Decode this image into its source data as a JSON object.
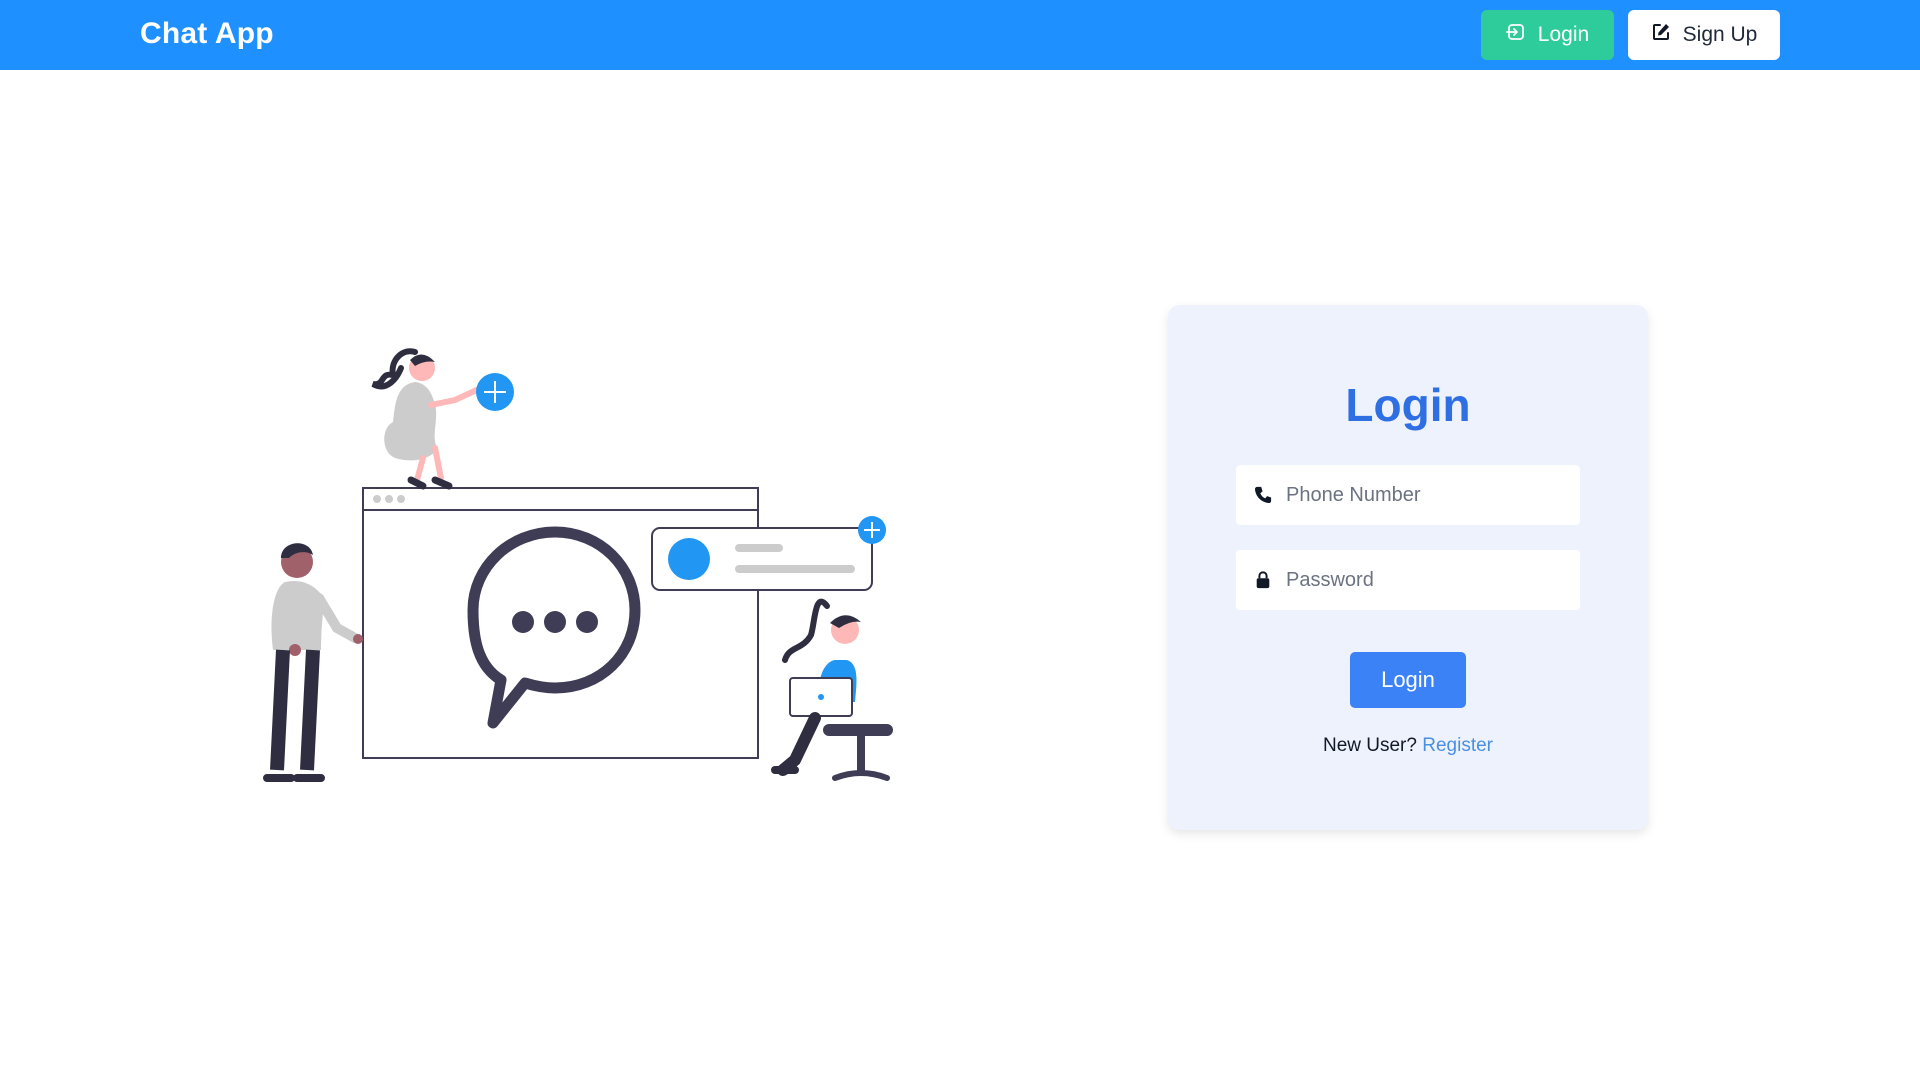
{
  "navbar": {
    "brand": "Chat App",
    "login_label": "Login",
    "signup_label": "Sign Up",
    "login_icon": "sign-in-icon",
    "signup_icon": "edit-icon"
  },
  "login_form": {
    "title": "Login",
    "phone": {
      "placeholder": "Phone Number",
      "value": "",
      "icon": "phone-icon"
    },
    "password": {
      "placeholder": "Password",
      "value": "",
      "icon": "lock-icon"
    },
    "submit_label": "Login",
    "new_user_text": "New User?",
    "register_label": "Register"
  },
  "illustration": {
    "subject": "people around chat window"
  },
  "colors": {
    "navbar": "#1e90ff",
    "nav_login_button": "#2ecc9a",
    "title": "#2f6fe4",
    "submit_button": "#3b82f6",
    "link": "#4a90e2",
    "card_background": "#eef2fd"
  }
}
